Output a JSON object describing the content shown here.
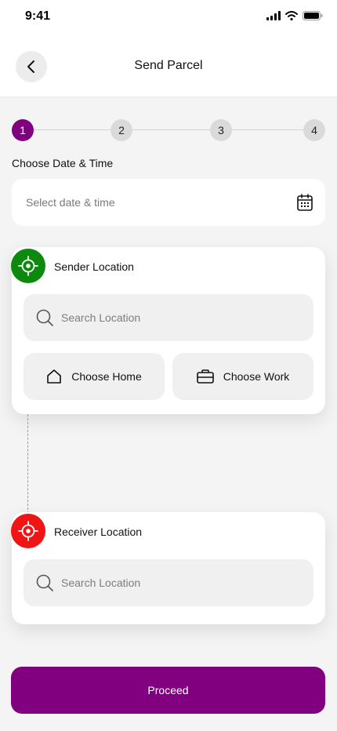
{
  "status_bar": {
    "time": "9:41"
  },
  "header": {
    "title": "Send Parcel"
  },
  "stepper": {
    "steps": [
      "1",
      "2",
      "3",
      "4"
    ],
    "active_step": "1"
  },
  "date_time": {
    "label": "Choose Date & Time",
    "placeholder": "Select date & time"
  },
  "sender": {
    "title": "Sender Location",
    "search_placeholder": "Search Location",
    "choose_home": "Choose Home",
    "choose_work": "Choose Work"
  },
  "receiver": {
    "title": "Receiver Location",
    "search_placeholder": "Search Location"
  },
  "actions": {
    "proceed": "Proceed"
  },
  "colors": {
    "primary": "#800080",
    "sender_pin": "#0d8a0d",
    "receiver_pin": "#f01414",
    "background": "#f4f4f4"
  },
  "icons": [
    "back-arrow-icon",
    "calendar-icon",
    "target-icon",
    "search-icon",
    "home-icon",
    "briefcase-icon",
    "signal-icon",
    "wifi-icon",
    "battery-icon"
  ]
}
